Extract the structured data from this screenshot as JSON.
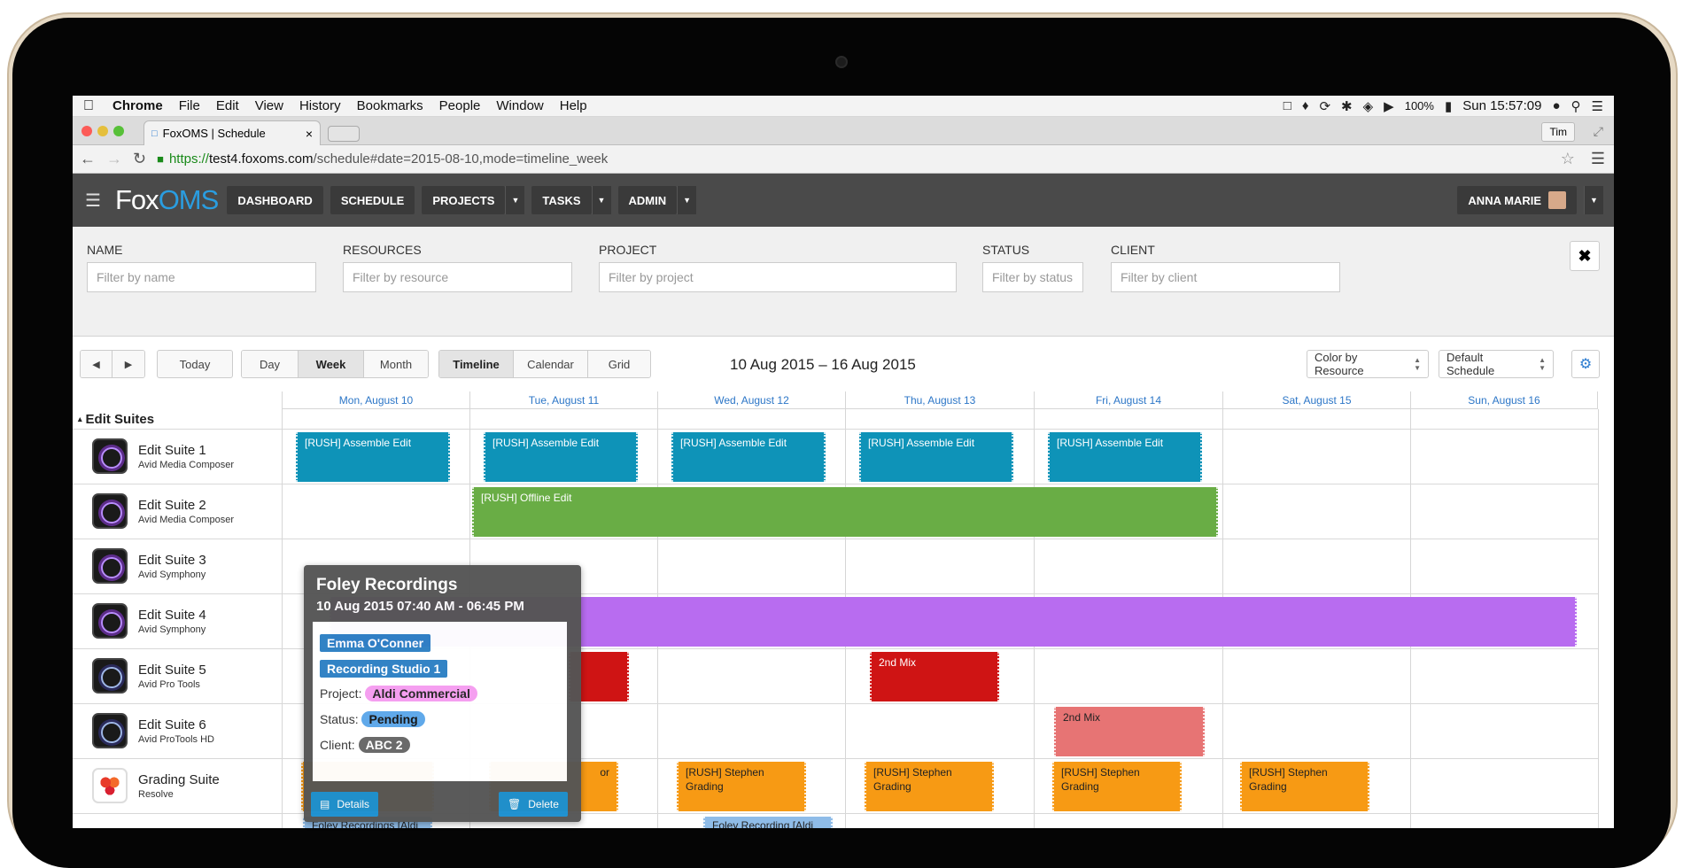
{
  "menubar": {
    "app": "Chrome",
    "items": [
      "File",
      "Edit",
      "View",
      "History",
      "Bookmarks",
      "People",
      "Window",
      "Help"
    ],
    "battery": "100%",
    "clock": "Sun 15:57:09"
  },
  "browser": {
    "tab_title": "FoxOMS | Schedule",
    "user": "Tim",
    "url_scheme": "https://",
    "url_host": "test4.foxoms.com",
    "url_path": "/schedule#date=2015-08-10,mode=timeline_week"
  },
  "appnav": {
    "logo_fox": "Fox",
    "logo_oms": "OMS",
    "dashboard": "DASHBOARD",
    "schedule": "SCHEDULE",
    "projects": "PROJECTS",
    "tasks": "TASKS",
    "admin": "ADMIN",
    "user": "ANNA MARIE"
  },
  "filters": {
    "name_label": "NAME",
    "name_placeholder": "Filter by name",
    "resources_label": "RESOURCES",
    "resources_placeholder": "Filter by resource",
    "project_label": "PROJECT",
    "project_placeholder": "Filter by project",
    "status_label": "STATUS",
    "status_placeholder": "Filter by status",
    "client_label": "CLIENT",
    "client_placeholder": "Filter by client",
    "close": "✖"
  },
  "toolbar": {
    "prev": "◀",
    "next": "▶",
    "today": "Today",
    "day": "Day",
    "week": "Week",
    "month": "Month",
    "timeline": "Timeline",
    "calendar": "Calendar",
    "grid": "Grid",
    "date_range": "10 Aug 2015 – 16 Aug 2015",
    "color_select": "Color by Resource",
    "schedule_select": "Default Schedule",
    "settings": "⚙"
  },
  "days": [
    "Mon, August 10",
    "Tue, August 11",
    "Wed, August 12",
    "Thu, August 13",
    "Fri, August 14",
    "Sat, August 15",
    "Sun, August 16"
  ],
  "group": "Edit Suites",
  "resources": [
    {
      "name": "Edit Suite 1",
      "sub": "Avid Media Composer"
    },
    {
      "name": "Edit Suite 2",
      "sub": "Avid Media Composer"
    },
    {
      "name": "Edit Suite 3",
      "sub": "Avid Symphony"
    },
    {
      "name": "Edit Suite 4",
      "sub": "Avid Symphony"
    },
    {
      "name": "Edit Suite 5",
      "sub": "Avid Pro Tools"
    },
    {
      "name": "Edit Suite 6",
      "sub": "Avid ProTools HD"
    },
    {
      "name": "Grading Suite",
      "sub": "Resolve"
    }
  ],
  "events": {
    "assemble": "[RUSH] Assemble Edit",
    "offline": "[RUSH] Offline Edit",
    "mix": "2nd Mix",
    "grading_1": "[RUSH] Stephen",
    "grading_2": "Grading",
    "partial_grading": "or",
    "foley_1": "Foley Recordings [Aldi",
    "foley_2": "Foley Recording [Aldi"
  },
  "colors": {
    "cyan": "#0e93b8",
    "green": "#69ad45",
    "purple": "#b86cf0",
    "red": "#cf1414",
    "salmon": "#e77474",
    "orange": "#f79a14"
  },
  "popover": {
    "title": "Foley Recordings",
    "time": "10 Aug 2015 07:40 AM - 06:45 PM",
    "person": "Emma O'Conner",
    "room": "Recording Studio 1",
    "project_label": "Project:",
    "project": "Aldi Commercial",
    "status_label": "Status:",
    "status": "Pending",
    "client_label": "Client:",
    "client": "ABC 2",
    "details": "Details",
    "delete": "Delete"
  }
}
